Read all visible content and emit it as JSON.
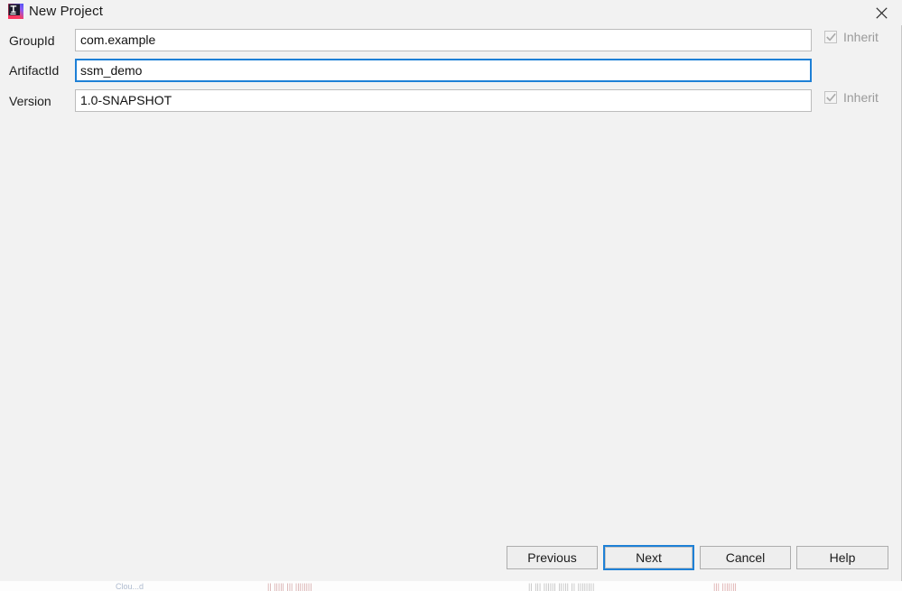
{
  "window": {
    "title": "New Project",
    "app_icon": "intellij-idea-icon",
    "close_icon": "close-icon",
    "accent_color": "#1e80d6",
    "background_color": "#f2f2f2",
    "field_background": "#ffffff",
    "border_color": "#bcbcbc"
  },
  "form": {
    "fields": [
      {
        "label": "GroupId",
        "value": "com.example",
        "placeholder": "",
        "focused": false,
        "inherit": {
          "label": "Inherit",
          "checked": true,
          "disabled": true
        }
      },
      {
        "label": "ArtifactId",
        "value": "ssm_demo",
        "placeholder": "",
        "focused": true,
        "inherit": null
      },
      {
        "label": "Version",
        "value": "1.0-SNAPSHOT",
        "placeholder": "",
        "focused": false,
        "inherit": {
          "label": "Inherit",
          "checked": true,
          "disabled": true
        }
      }
    ]
  },
  "buttons": {
    "previous": "Previous",
    "next": "Next",
    "cancel": "Cancel",
    "help": "Help",
    "default": "Next"
  },
  "backdrop": {
    "fragments": [
      "Clou...d",
      "|| ||||| ||| ||||||||",
      "|| ||| |||||| ||||| || ||||||||",
      "||| |||||||"
    ]
  }
}
